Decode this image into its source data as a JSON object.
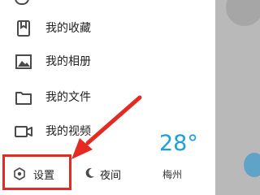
{
  "menu": {
    "items": [
      {
        "label": "我的收藏",
        "icon": "bookmark-icon"
      },
      {
        "label": "我的相册",
        "icon": "image-icon"
      },
      {
        "label": "我的文件",
        "icon": "folder-icon"
      },
      {
        "label": "我的视频",
        "icon": "video-icon"
      }
    ]
  },
  "bottom": {
    "settings_label": "设置",
    "settings_icon": "settings-icon",
    "night_label": "夜间",
    "night_icon": "moon-icon"
  },
  "weather": {
    "temperature": "28°",
    "city": "梅州"
  },
  "colors": {
    "accent_red": "#e52b21",
    "weather_blue": "#1aa0df",
    "icon_gray": "#4a4a4a"
  }
}
